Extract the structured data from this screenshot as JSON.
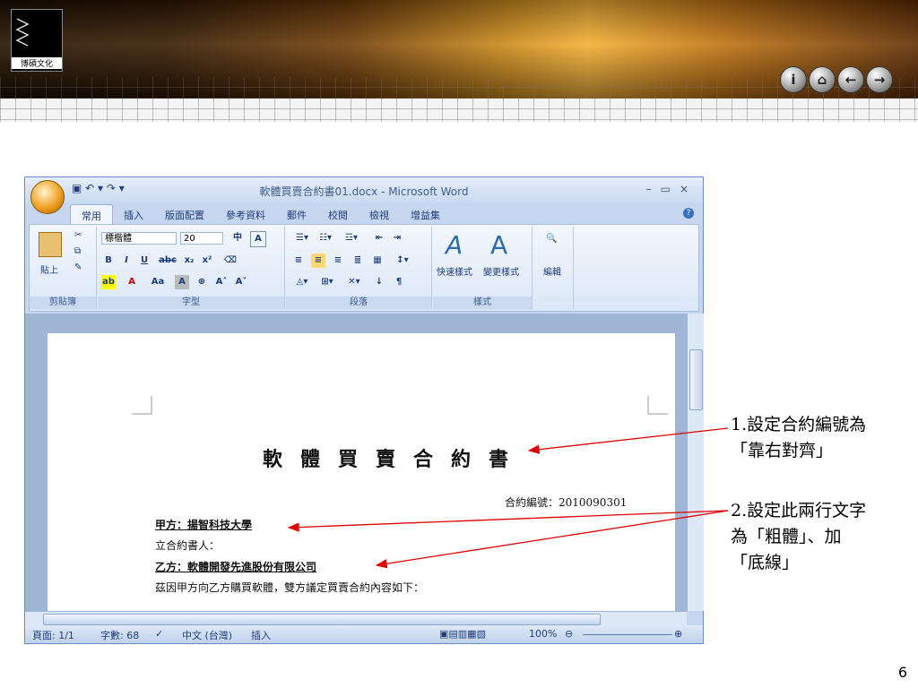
{
  "slide": {
    "logo_text": "博碩文化",
    "page_number": "6",
    "nav_buttons": [
      "info-icon",
      "home-icon",
      "back-arrow-icon",
      "forward-arrow-icon"
    ]
  },
  "word": {
    "title": "軟體買賣合約書01.docx - Microsoft Word",
    "tabs": [
      "常用",
      "插入",
      "版面配置",
      "參考資料",
      "郵件",
      "校閱",
      "檢視",
      "增益集"
    ],
    "ribbon": {
      "clipboard_label": "剪貼簿",
      "paste_label": "貼上",
      "font_label": "字型",
      "font_name": "標楷體",
      "font_size": "20",
      "paragraph_label": "段落",
      "styles_label": "樣式",
      "quick_styles": "快速樣式",
      "change_styles": "變更樣式",
      "editing": "編輯"
    },
    "document": {
      "title": "軟體買賣合約書",
      "contract_no": "合約編號：2010090301",
      "party_a": "甲方：揚智科技大學",
      "signatory": "立合約書人：",
      "party_b": "乙方：軟體開發先進股份有限公司",
      "body": "茲因甲方向乙方購買軟體，雙方議定買賣合約內容如下："
    },
    "status": {
      "page": "頁面: 1/1",
      "words": "字數: 68",
      "language": "中文 (台灣)",
      "mode": "插入",
      "zoom": "100%"
    }
  },
  "annotations": {
    "note1_line1": "1.設定合約編號為",
    "note1_line2": "「靠右對齊」",
    "note2_line1": "2.設定此兩行文字",
    "note2_line2": "為「粗體」、加",
    "note2_line3": "「底線」"
  },
  "colors": {
    "arrow": "#e00000",
    "banner_accent": "#f4b23a"
  }
}
